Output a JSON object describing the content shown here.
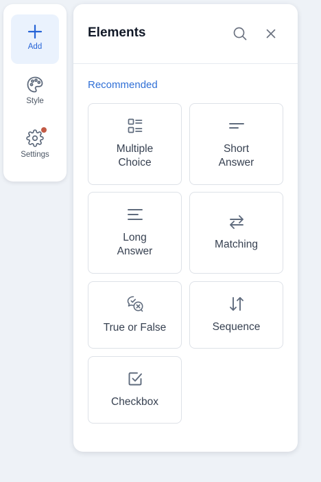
{
  "rail": {
    "items": [
      {
        "label": "Add",
        "icon": "plus-icon",
        "active": true
      },
      {
        "label": "Style",
        "icon": "palette-icon",
        "active": false
      },
      {
        "label": "Settings",
        "icon": "gear-icon",
        "active": false,
        "has_notification": true
      }
    ]
  },
  "panel": {
    "title": "Elements",
    "section_title": "Recommended",
    "cards": [
      {
        "label_lines": [
          "Multiple",
          "Choice"
        ],
        "icon": "multiple-choice-icon"
      },
      {
        "label_lines": [
          "Short",
          "Answer"
        ],
        "icon": "short-answer-icon"
      },
      {
        "label_lines": [
          "Long",
          "Answer"
        ],
        "icon": "long-answer-icon"
      },
      {
        "label_lines": [
          "Matching"
        ],
        "icon": "matching-arrows-icon"
      },
      {
        "label_lines": [
          "True or False"
        ],
        "icon": "true-false-icon"
      },
      {
        "label_lines": [
          "Sequence"
        ],
        "icon": "sequence-arrows-icon"
      },
      {
        "label_lines": [
          "Checkbox"
        ],
        "icon": "checkbox-icon"
      }
    ]
  },
  "colors": {
    "accent": "#2563d6",
    "notification": "#c25a45",
    "icon": "#5f6b7d",
    "background": "#eef2f7"
  }
}
